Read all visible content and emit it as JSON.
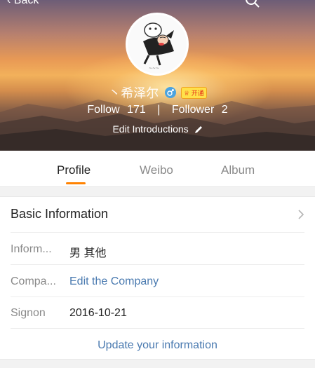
{
  "header": {
    "back_label": "Back",
    "username": "丶希泽尔",
    "vip_badge": "开通",
    "follow_label": "Follow",
    "follow_count": "171",
    "separator": "|",
    "follower_label": "Follower",
    "follower_count": "2",
    "edit_intro": "Edit Introductions"
  },
  "tabs": [
    {
      "label": "Profile",
      "active": true
    },
    {
      "label": "Weibo",
      "active": false
    },
    {
      "label": "Album",
      "active": false
    }
  ],
  "basic_info": {
    "title": "Basic Information",
    "rows": [
      {
        "label": "Inform...",
        "value": "男  其他"
      },
      {
        "label": "Compa...",
        "value": "Edit the Company"
      },
      {
        "label": "Signon",
        "value": "2016-10-21"
      }
    ],
    "update_link": "Update your information"
  },
  "colors": {
    "accent": "#ff8200",
    "link": "#4a7ab0",
    "gender_icon": "#4aa3e0"
  },
  "icons": [
    "chevron-left-icon",
    "search-icon",
    "gender-male-icon",
    "vip-crown-icon",
    "pencil-icon",
    "chevron-right-icon"
  ]
}
